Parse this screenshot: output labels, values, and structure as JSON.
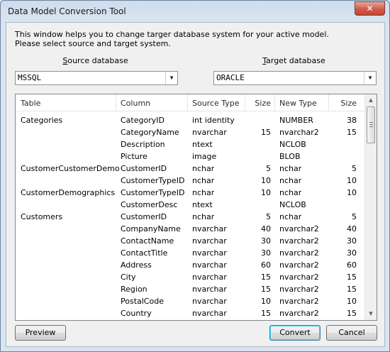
{
  "window": {
    "title": "Data Model Conversion Tool",
    "close_glyph": "✕"
  },
  "intro": {
    "line1": "This window helps you to change targer database system for your active model.",
    "line2": "Please select source and target system."
  },
  "source": {
    "label_ul": "S",
    "label_rest": "ource database",
    "value": "MSSQL"
  },
  "target": {
    "label_ul": "T",
    "label_rest": "arget database",
    "value": "ORACLE"
  },
  "grid": {
    "columns": [
      "Table",
      "Column",
      "Source Type",
      "Size",
      "New Type",
      "Size"
    ],
    "rows": [
      [
        "Categories",
        "CategoryID",
        "int identity",
        "",
        "NUMBER",
        "38"
      ],
      [
        "",
        "CategoryName",
        "nvarchar",
        "15",
        "nvarchar2",
        "15"
      ],
      [
        "",
        "Description",
        "ntext",
        "",
        "NCLOB",
        ""
      ],
      [
        "",
        "Picture",
        "image",
        "",
        "BLOB",
        ""
      ],
      [
        "CustomerCustomerDemo",
        "CustomerID",
        "nchar",
        "5",
        "nchar",
        "5"
      ],
      [
        "",
        "CustomerTypeID",
        "nchar",
        "10",
        "nchar",
        "10"
      ],
      [
        "CustomerDemographics",
        "CustomerTypeID",
        "nchar",
        "10",
        "nchar",
        "10"
      ],
      [
        "",
        "CustomerDesc",
        "ntext",
        "",
        "NCLOB",
        ""
      ],
      [
        "Customers",
        "CustomerID",
        "nchar",
        "5",
        "nchar",
        "5"
      ],
      [
        "",
        "CompanyName",
        "nvarchar",
        "40",
        "nvarchar2",
        "40"
      ],
      [
        "",
        "ContactName",
        "nvarchar",
        "30",
        "nvarchar2",
        "30"
      ],
      [
        "",
        "ContactTitle",
        "nvarchar",
        "30",
        "nvarchar2",
        "30"
      ],
      [
        "",
        "Address",
        "nvarchar",
        "60",
        "nvarchar2",
        "60"
      ],
      [
        "",
        "City",
        "nvarchar",
        "15",
        "nvarchar2",
        "15"
      ],
      [
        "",
        "Region",
        "nvarchar",
        "15",
        "nvarchar2",
        "15"
      ],
      [
        "",
        "PostalCode",
        "nvarchar",
        "10",
        "nvarchar2",
        "10"
      ],
      [
        "",
        "Country",
        "nvarchar",
        "15",
        "nvarchar2",
        "15"
      ]
    ]
  },
  "buttons": {
    "preview": "Preview",
    "convert": "Convert",
    "cancel": "Cancel"
  },
  "icons": {
    "dropdown": "chevron-down-icon",
    "scroll_up": "scroll-up-arrow-icon",
    "scroll_down": "scroll-down-arrow-icon"
  },
  "colors": {
    "accent": "#3c7fb1",
    "close": "#c24434"
  }
}
